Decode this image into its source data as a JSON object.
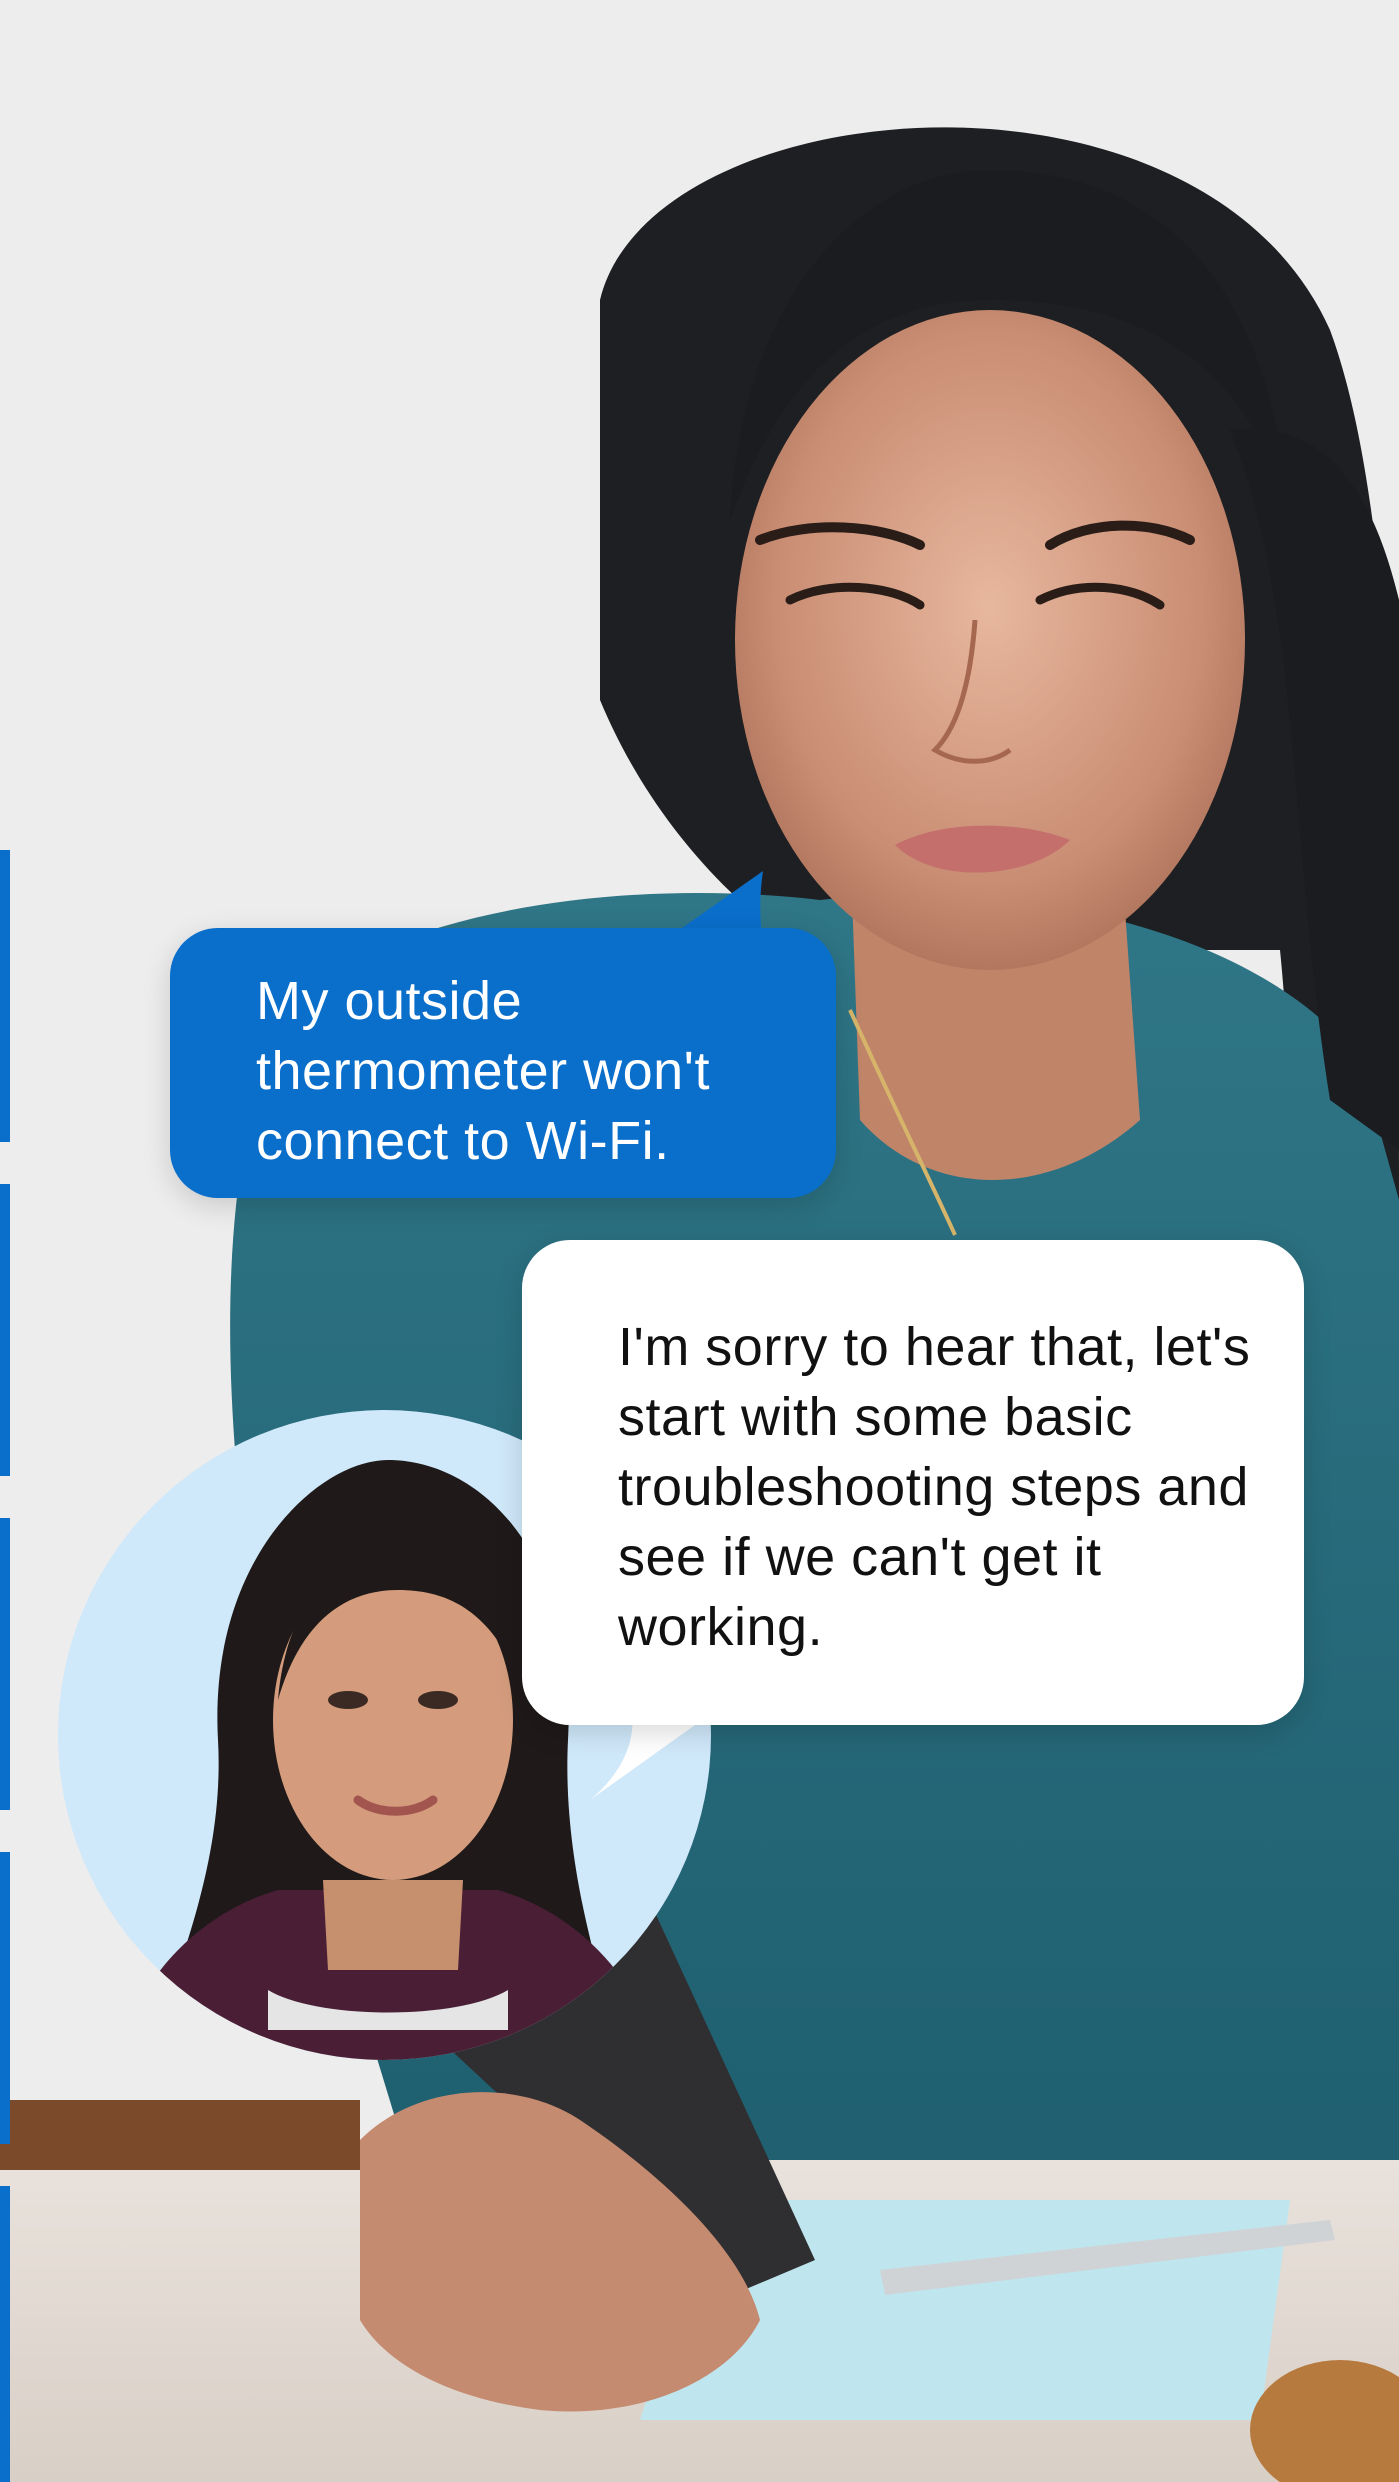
{
  "colors": {
    "background": "#ededed",
    "accent_blue": "#0a6ecb",
    "agent_bubble": "#ffffff",
    "avatar_bg": "#cfe8fa"
  },
  "conversation": {
    "user_message": "My outside thermometer won't connect to Wi-Fi.",
    "agent_message": "I'm sorry to hear that, let's start with some basic troubleshooting steps and see if we can't get it working."
  },
  "images": {
    "photo": "woman-looking-at-phone-photo",
    "avatar": "virtual-agent-avatar"
  }
}
